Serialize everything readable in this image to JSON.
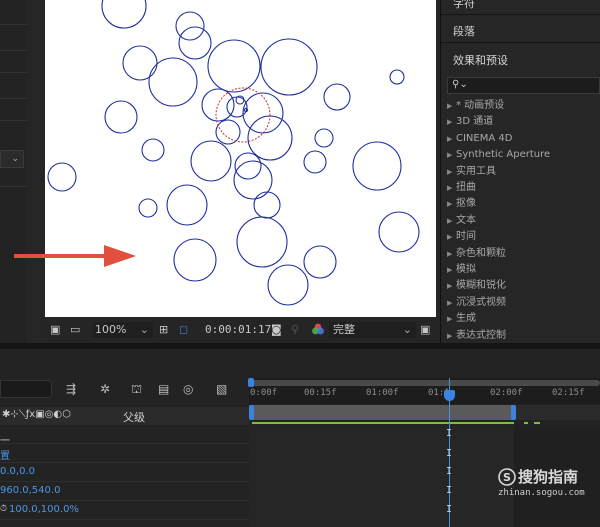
{
  "viewer": {
    "toolbar": {
      "zoom": "100%",
      "timecode": "0:00:01:17",
      "resolution": "完整"
    }
  },
  "right_panel": {
    "top_tab": "字符",
    "paragraph_tab": "段落",
    "effects_title": "效果和预设",
    "search_icon": "search-icon",
    "categories": [
      "* 动画预设",
      "3D 通道",
      "CINEMA 4D",
      "Synthetic Aperture",
      "实用工具",
      "扭曲",
      "抠像",
      "文本",
      "时间",
      "杂色和颗粒",
      "模拟",
      "模糊和锐化",
      "沉浸式视频",
      "生成",
      "表达式控制"
    ]
  },
  "timeline": {
    "column_header": "父级",
    "ruler_labels": [
      "0:00f",
      "00:15f",
      "01:00f",
      "01:1",
      "02:00f",
      "02:15f"
    ],
    "properties": [
      "置",
      "0.0,0.0",
      "960.0,540.0",
      "100.0,100.0%"
    ]
  },
  "watermark": {
    "brand": "搜狗指南",
    "url": "zhinan.sogou.com"
  },
  "colors": {
    "circle_stroke": "#1e2f9e",
    "accent_circle": "#c03030",
    "arrow": "#e0503c",
    "playhead": "#4a8fe0",
    "work_area_green": "#76c043"
  }
}
